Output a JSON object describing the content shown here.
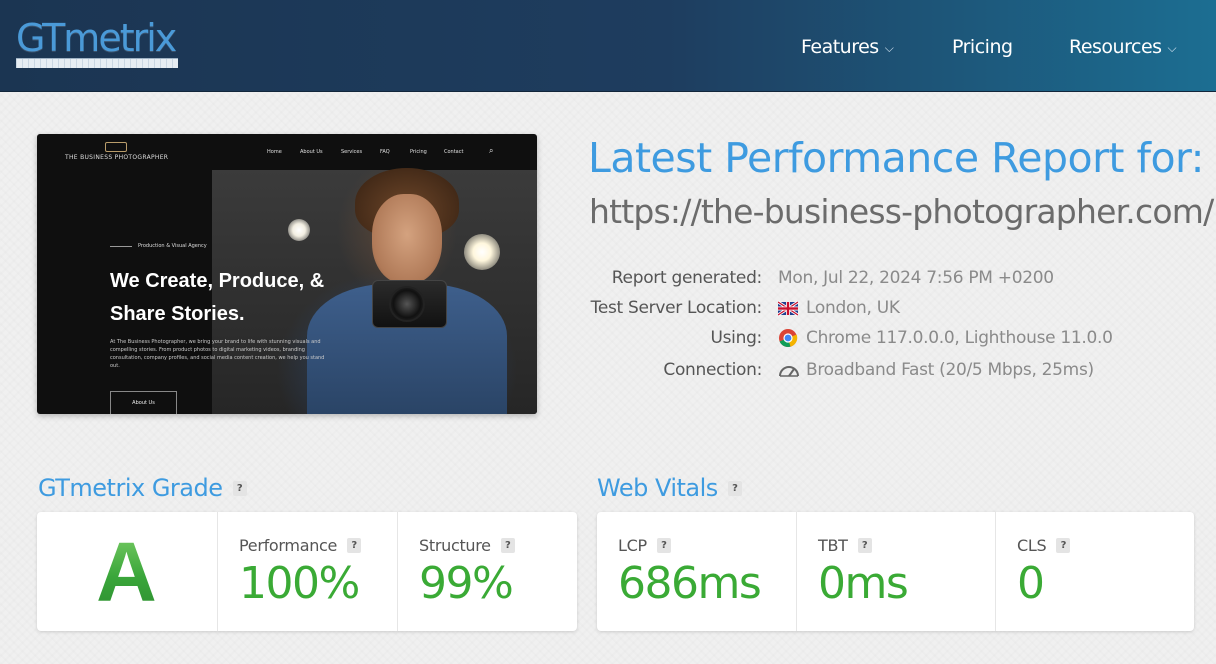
{
  "header": {
    "logo_text": "GTmetrix",
    "nav": [
      {
        "label": "Features",
        "dropdown": true
      },
      {
        "label": "Pricing",
        "dropdown": false
      },
      {
        "label": "Resources",
        "dropdown": true
      }
    ]
  },
  "preview": {
    "brand": "THE BUSINESS PHOTOGRAPHER",
    "nav": [
      "Home",
      "About Us",
      "Services",
      "FAQ",
      "Pricing",
      "Contact"
    ],
    "tagline": "Production & Visual Agency",
    "headline": "We Create, Produce, & Share Stories.",
    "paragraph": "At The Business Photographer, we bring your brand to life with stunning visuals and compelling stories. From product photos to digital marketing videos, branding consultation, company profiles, and social media content creation, we help you stand out.",
    "button": "About Us"
  },
  "report": {
    "title": "Latest Performance Report for:",
    "url": "https://the-business-photographer.com/",
    "meta": [
      {
        "label": "Report generated:",
        "value": "Mon, Jul 22, 2024 7:56 PM +0200",
        "icon": null
      },
      {
        "label": "Test Server Location:",
        "value": "London, UK",
        "icon": "uk-flag-icon"
      },
      {
        "label": "Using:",
        "value": "Chrome 117.0.0.0, Lighthouse 11.0.0",
        "icon": "chrome-icon"
      },
      {
        "label": "Connection:",
        "value": "Broadband Fast (20/5 Mbps, 25ms)",
        "icon": "speedometer-icon"
      }
    ]
  },
  "grade_section": {
    "title": "GTmetrix Grade",
    "help": "?",
    "grade": "A",
    "metrics": [
      {
        "label": "Performance",
        "value": "100%"
      },
      {
        "label": "Structure",
        "value": "99%"
      }
    ]
  },
  "vitals_section": {
    "title": "Web Vitals",
    "help": "?",
    "metrics": [
      {
        "label": "LCP",
        "value": "686ms"
      },
      {
        "label": "TBT",
        "value": "0ms"
      },
      {
        "label": "CLS",
        "value": "0"
      }
    ]
  },
  "colors": {
    "accent_blue": "#3e9be0",
    "good_green": "#3aaa35",
    "header_dark": "#1b3552",
    "header_teal": "#1c6e92"
  }
}
